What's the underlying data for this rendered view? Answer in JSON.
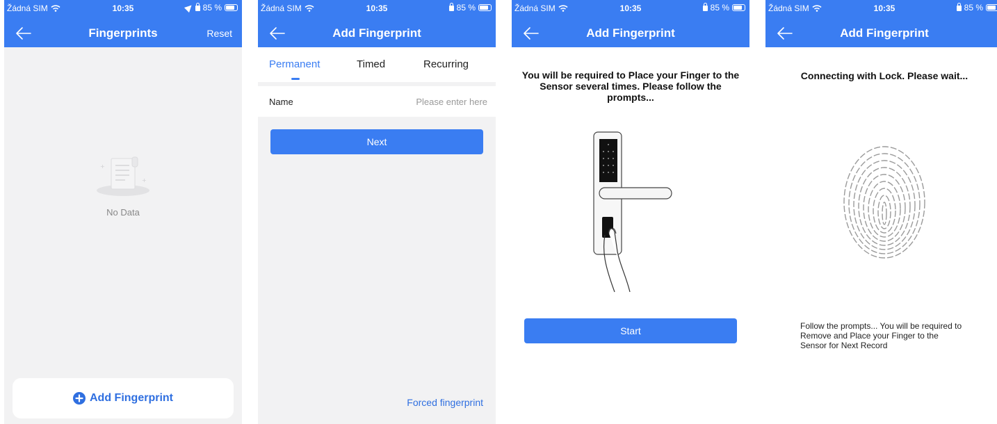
{
  "status_bar": {
    "carrier": "Žádná SIM",
    "time": "10:35",
    "battery": "85 %"
  },
  "screen1": {
    "title": "Fingerprints",
    "reset_label": "Reset",
    "empty_text": "No Data",
    "add_label": "Add Fingerprint"
  },
  "screen2": {
    "title": "Add Fingerprint",
    "tabs": [
      "Permanent",
      "Timed",
      "Recurring"
    ],
    "active_tab": "Permanent",
    "name_label": "Name",
    "name_placeholder": "Please enter here",
    "next_label": "Next",
    "forced_label": "Forced fingerprint"
  },
  "screen3": {
    "title": "Add Fingerprint",
    "instruction": "You will be required to Place your Finger to the Sensor several times. Please follow the prompts...",
    "start_label": "Start"
  },
  "screen4": {
    "title": "Add Fingerprint",
    "connecting": "Connecting with Lock. Please wait...",
    "follow_text": "Follow the prompts... You will be required to Remove and Place your Finger to the Sensor for Next Record"
  },
  "colors": {
    "primary": "#3a7df2",
    "link": "#2f6fe0",
    "background_grey": "#f2f2f3"
  }
}
